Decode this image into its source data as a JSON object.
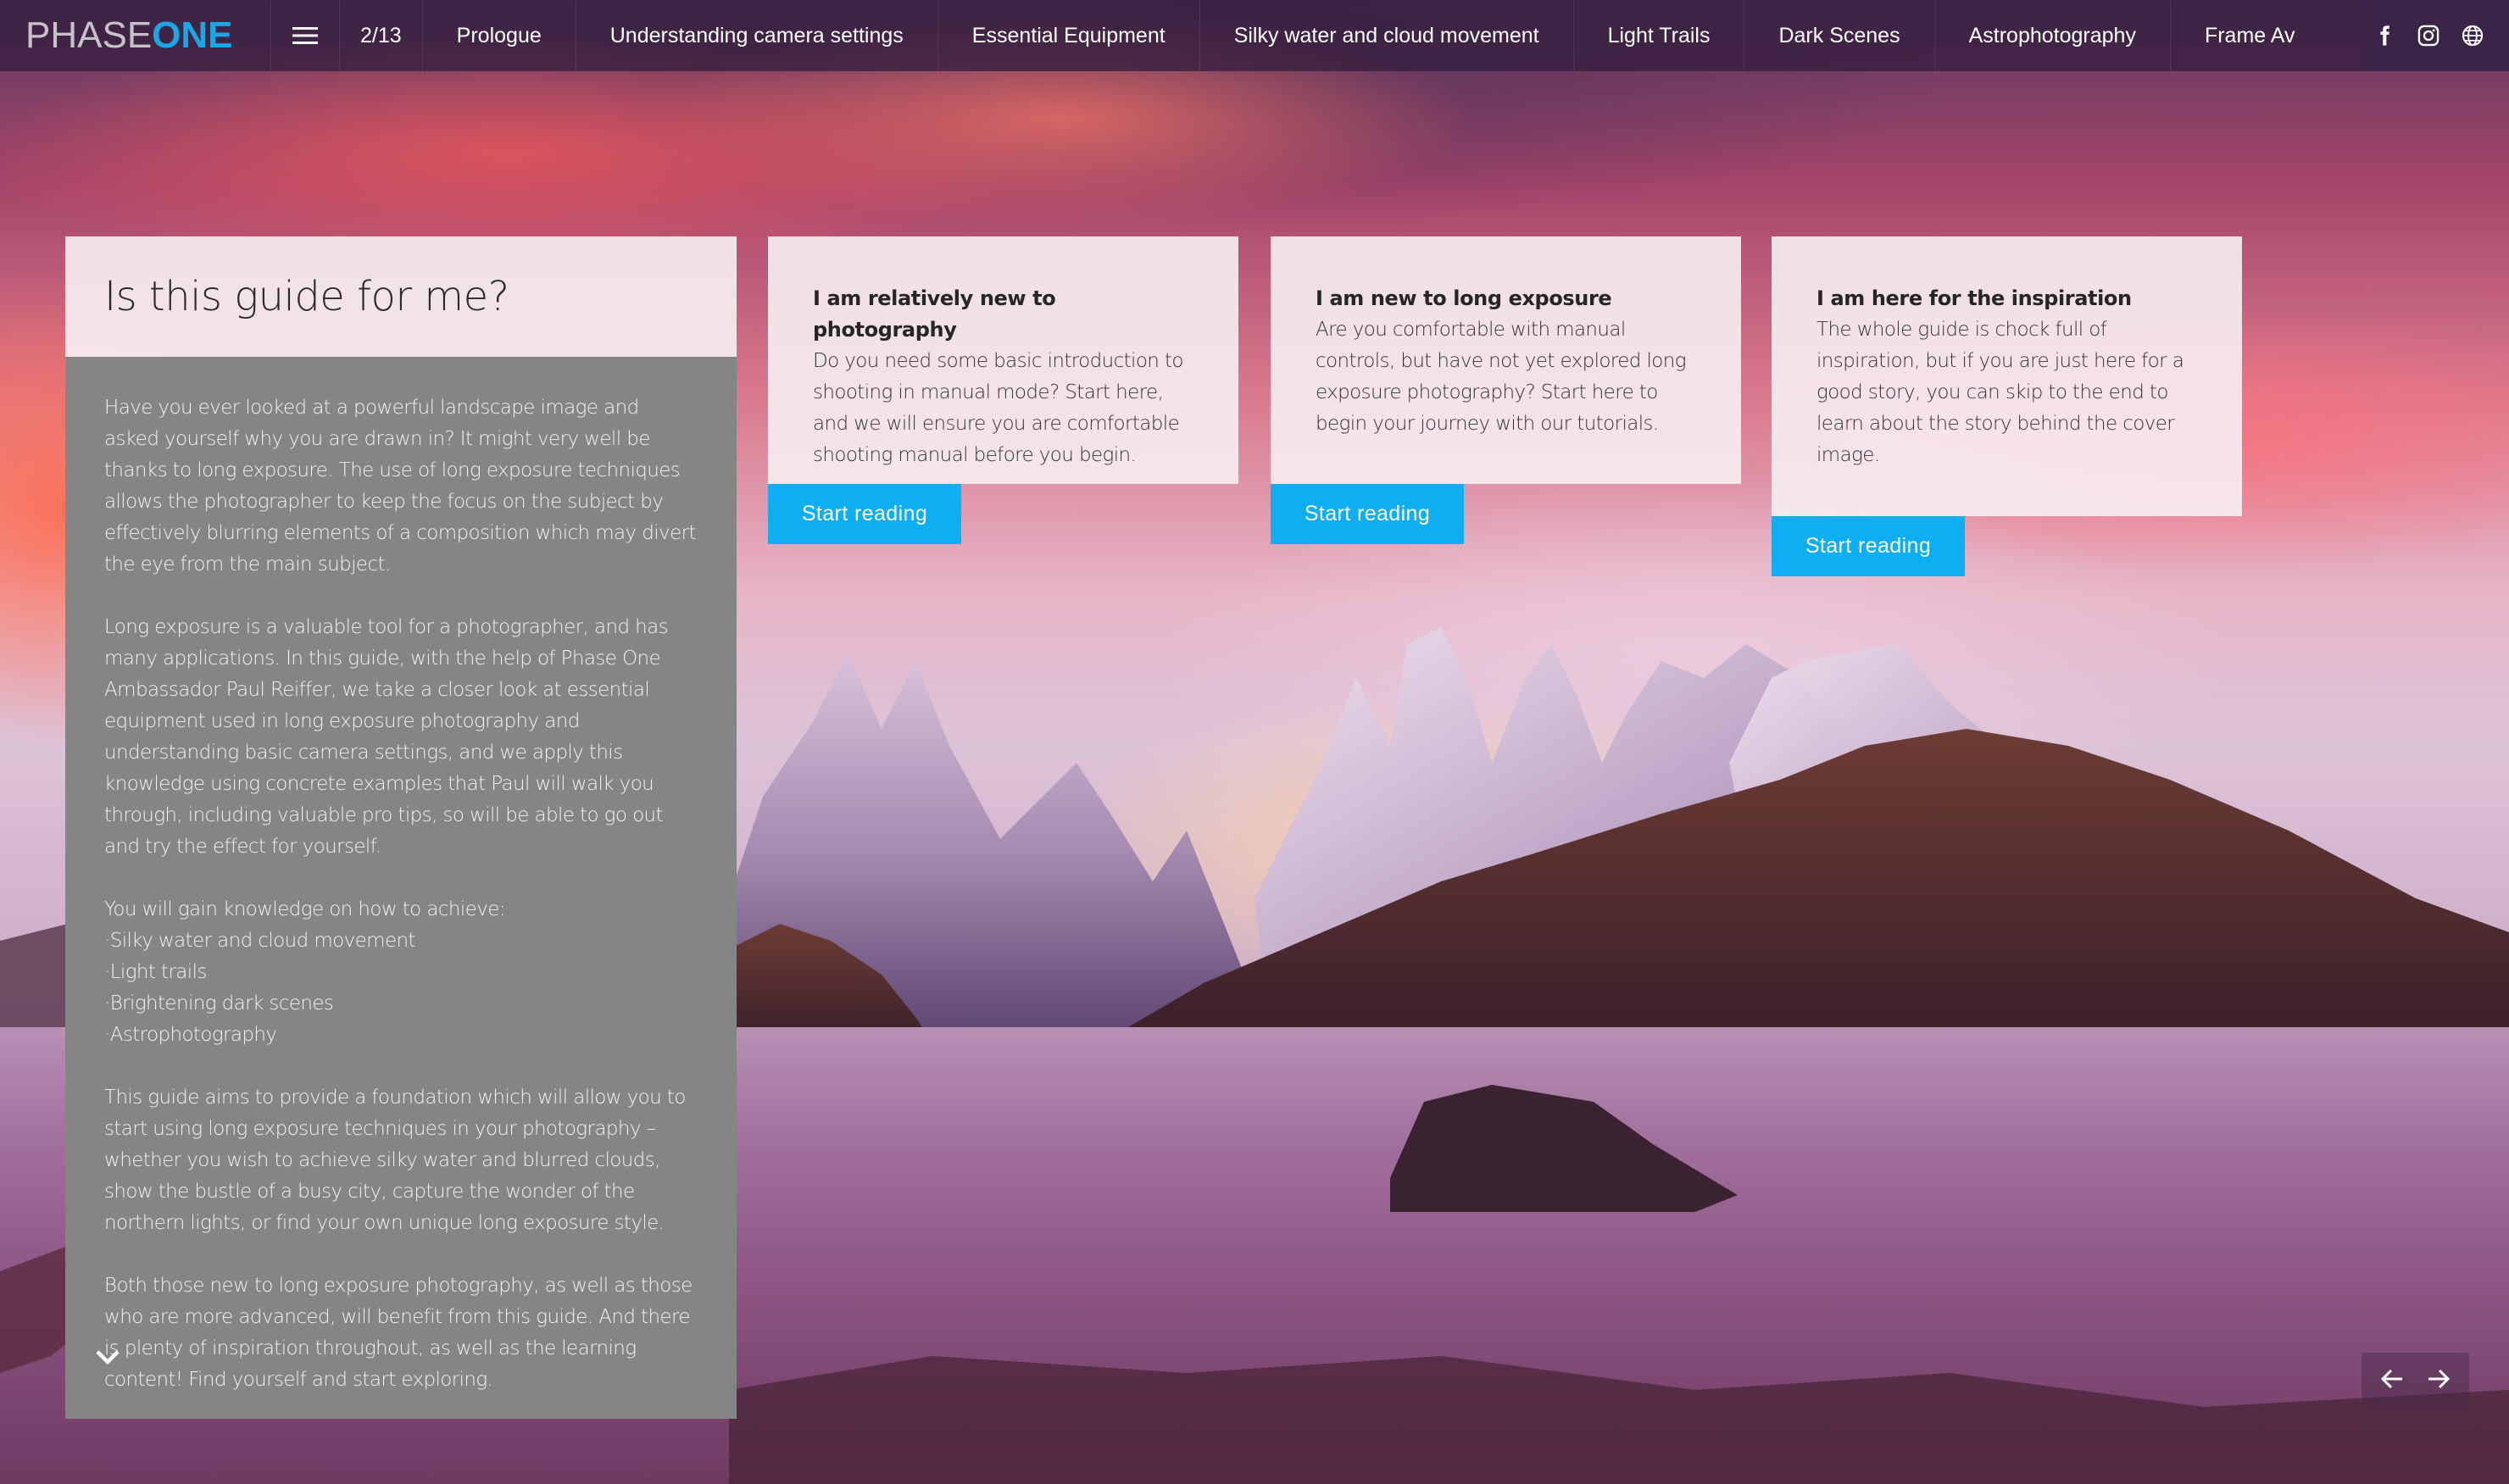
{
  "header": {
    "logo": {
      "part1": "PHASE",
      "part2": "ONE"
    },
    "menu_icon": "hamburger-menu-icon",
    "page_indicator": "2/13",
    "nav_items": [
      {
        "label": "Prologue"
      },
      {
        "label": "Understanding camera settings"
      },
      {
        "label": "Essential Equipment"
      },
      {
        "label": "Silky water and cloud movement"
      },
      {
        "label": "Light Trails"
      },
      {
        "label": "Dark Scenes"
      },
      {
        "label": "Astrophotography"
      },
      {
        "label": "Frame Av"
      }
    ],
    "social": [
      {
        "name": "facebook-icon"
      },
      {
        "name": "instagram-icon"
      },
      {
        "name": "globe-icon"
      }
    ]
  },
  "intro": {
    "title": "Is this guide for me?",
    "paragraphs": [
      "Have you ever looked at a powerful landscape image and asked yourself why you are drawn in? It might very well be thanks to long exposure. The use of long exposure techniques allows the photographer to keep the focus on the subject by effectively blurring elements of a composition which may divert the eye from the main subject.",
      "Long exposure is a valuable tool for a photographer, and has many applications. In this guide, with the help of Phase One Ambassador Paul Reiffer, we take a closer look at essential equipment used in long exposure photography and understanding basic camera settings, and we apply this knowledge using concrete examples that Paul will walk you through, including valuable pro tips, so will be able to go out and try the effect for yourself.",
      "You will gain knowledge on how to achieve:",
      "This guide aims to provide a foundation which will allow you to start using long exposure techniques in your photography – whether you wish to achieve silky water and blurred clouds, show the bustle of a busy city, capture the wonder of the northern lights, or find your own unique long exposure style.",
      "Both those new to long exposure photography, as well as those who are more advanced, will benefit from this guide. And there is plenty of inspiration throughout, as well as the learning content! Find yourself and start exploring."
    ],
    "bullets": [
      "Silky water and cloud movement",
      "Light trails",
      "Brightening dark scenes",
      "Astrophotography"
    ]
  },
  "cards": [
    {
      "title": "I am relatively new to photography",
      "text": "Do you need some basic introduction to shooting in manual mode? Start here, and we will ensure you are comfortable shooting manual before you begin.",
      "button": "Start reading"
    },
    {
      "title": "I am new to long exposure",
      "text": "Are you comfortable with manual controls, but have not yet explored long exposure photography? Start here to begin your journey with our tutorials.",
      "button": "Start reading"
    },
    {
      "title": "I am here for the inspiration",
      "text": "The whole guide is chock full of inspiration, but if you are just here for a good story, you can skip to the end to learn about the story behind the cover image.",
      "button": "Start reading"
    }
  ],
  "pager": {
    "prev": "arrow-left-icon",
    "next": "arrow-right-icon"
  },
  "colors": {
    "brand_blue": "#1ba7e6",
    "button_blue": "#0eaef2",
    "panel_gray": "#858585",
    "header_bg": "#341e3e"
  }
}
